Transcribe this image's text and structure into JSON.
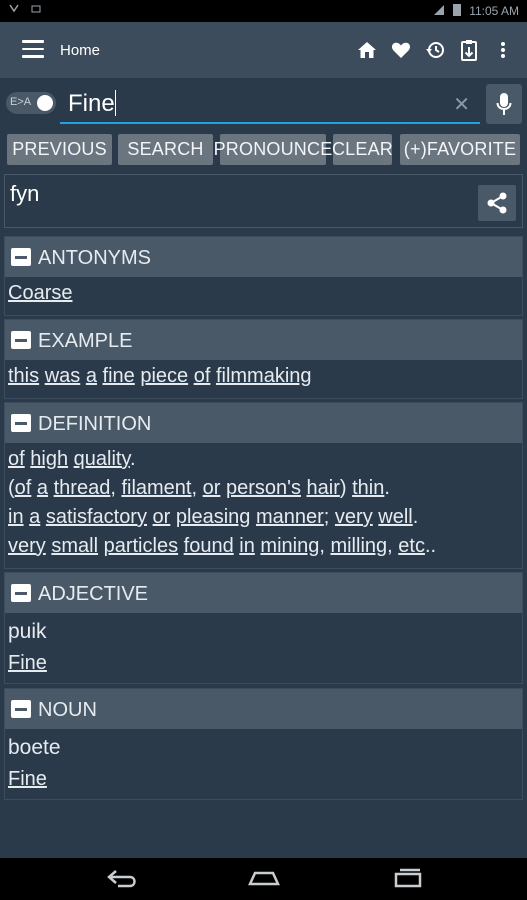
{
  "status": {
    "time": "11:05 AM"
  },
  "appbar": {
    "title": "Home"
  },
  "search": {
    "toggle_label": "E>A",
    "value": "Fine"
  },
  "buttons": {
    "previous": "PREVIOUS",
    "search": "SEARCH",
    "pronounce": "PRONOUNCE",
    "clear": "CLEAR",
    "favorite": "(+)FAVORITE"
  },
  "phonetic": "fyn",
  "sections": {
    "antonyms": {
      "title": "ANTONYMS",
      "items": [
        "Coarse"
      ]
    },
    "example": {
      "title": "EXAMPLE",
      "words": [
        "this",
        "was",
        "a",
        "fine",
        "piece",
        "of",
        "filmmaking"
      ]
    },
    "definition": {
      "title": "DEFINITION",
      "line1": {
        "words": [
          "of",
          "high",
          "quality"
        ],
        "tail": "."
      },
      "line2": {
        "open": "(",
        "words": [
          "of",
          "a",
          "thread"
        ],
        "w4": "filament",
        "w5": "or",
        "w6": "person's",
        "w7": "hair",
        "close": ")",
        "w8": "thin",
        "tail": "."
      },
      "line3": {
        "words": [
          "in",
          "a",
          "satisfactory",
          "or",
          "pleasing",
          "manner"
        ],
        "semi": ";",
        "w7": "very",
        "w8": "well",
        "tail": "."
      },
      "line4": {
        "words": [
          "very",
          "small",
          "particles",
          "found",
          "in",
          "mining"
        ],
        "w7": "milling",
        "w8": "etc",
        "tail": ".."
      }
    },
    "adjective": {
      "title": "ADJECTIVE",
      "term": "puik",
      "link": "Fine"
    },
    "noun": {
      "title": "NOUN",
      "term": "boete",
      "link": "Fine"
    }
  }
}
